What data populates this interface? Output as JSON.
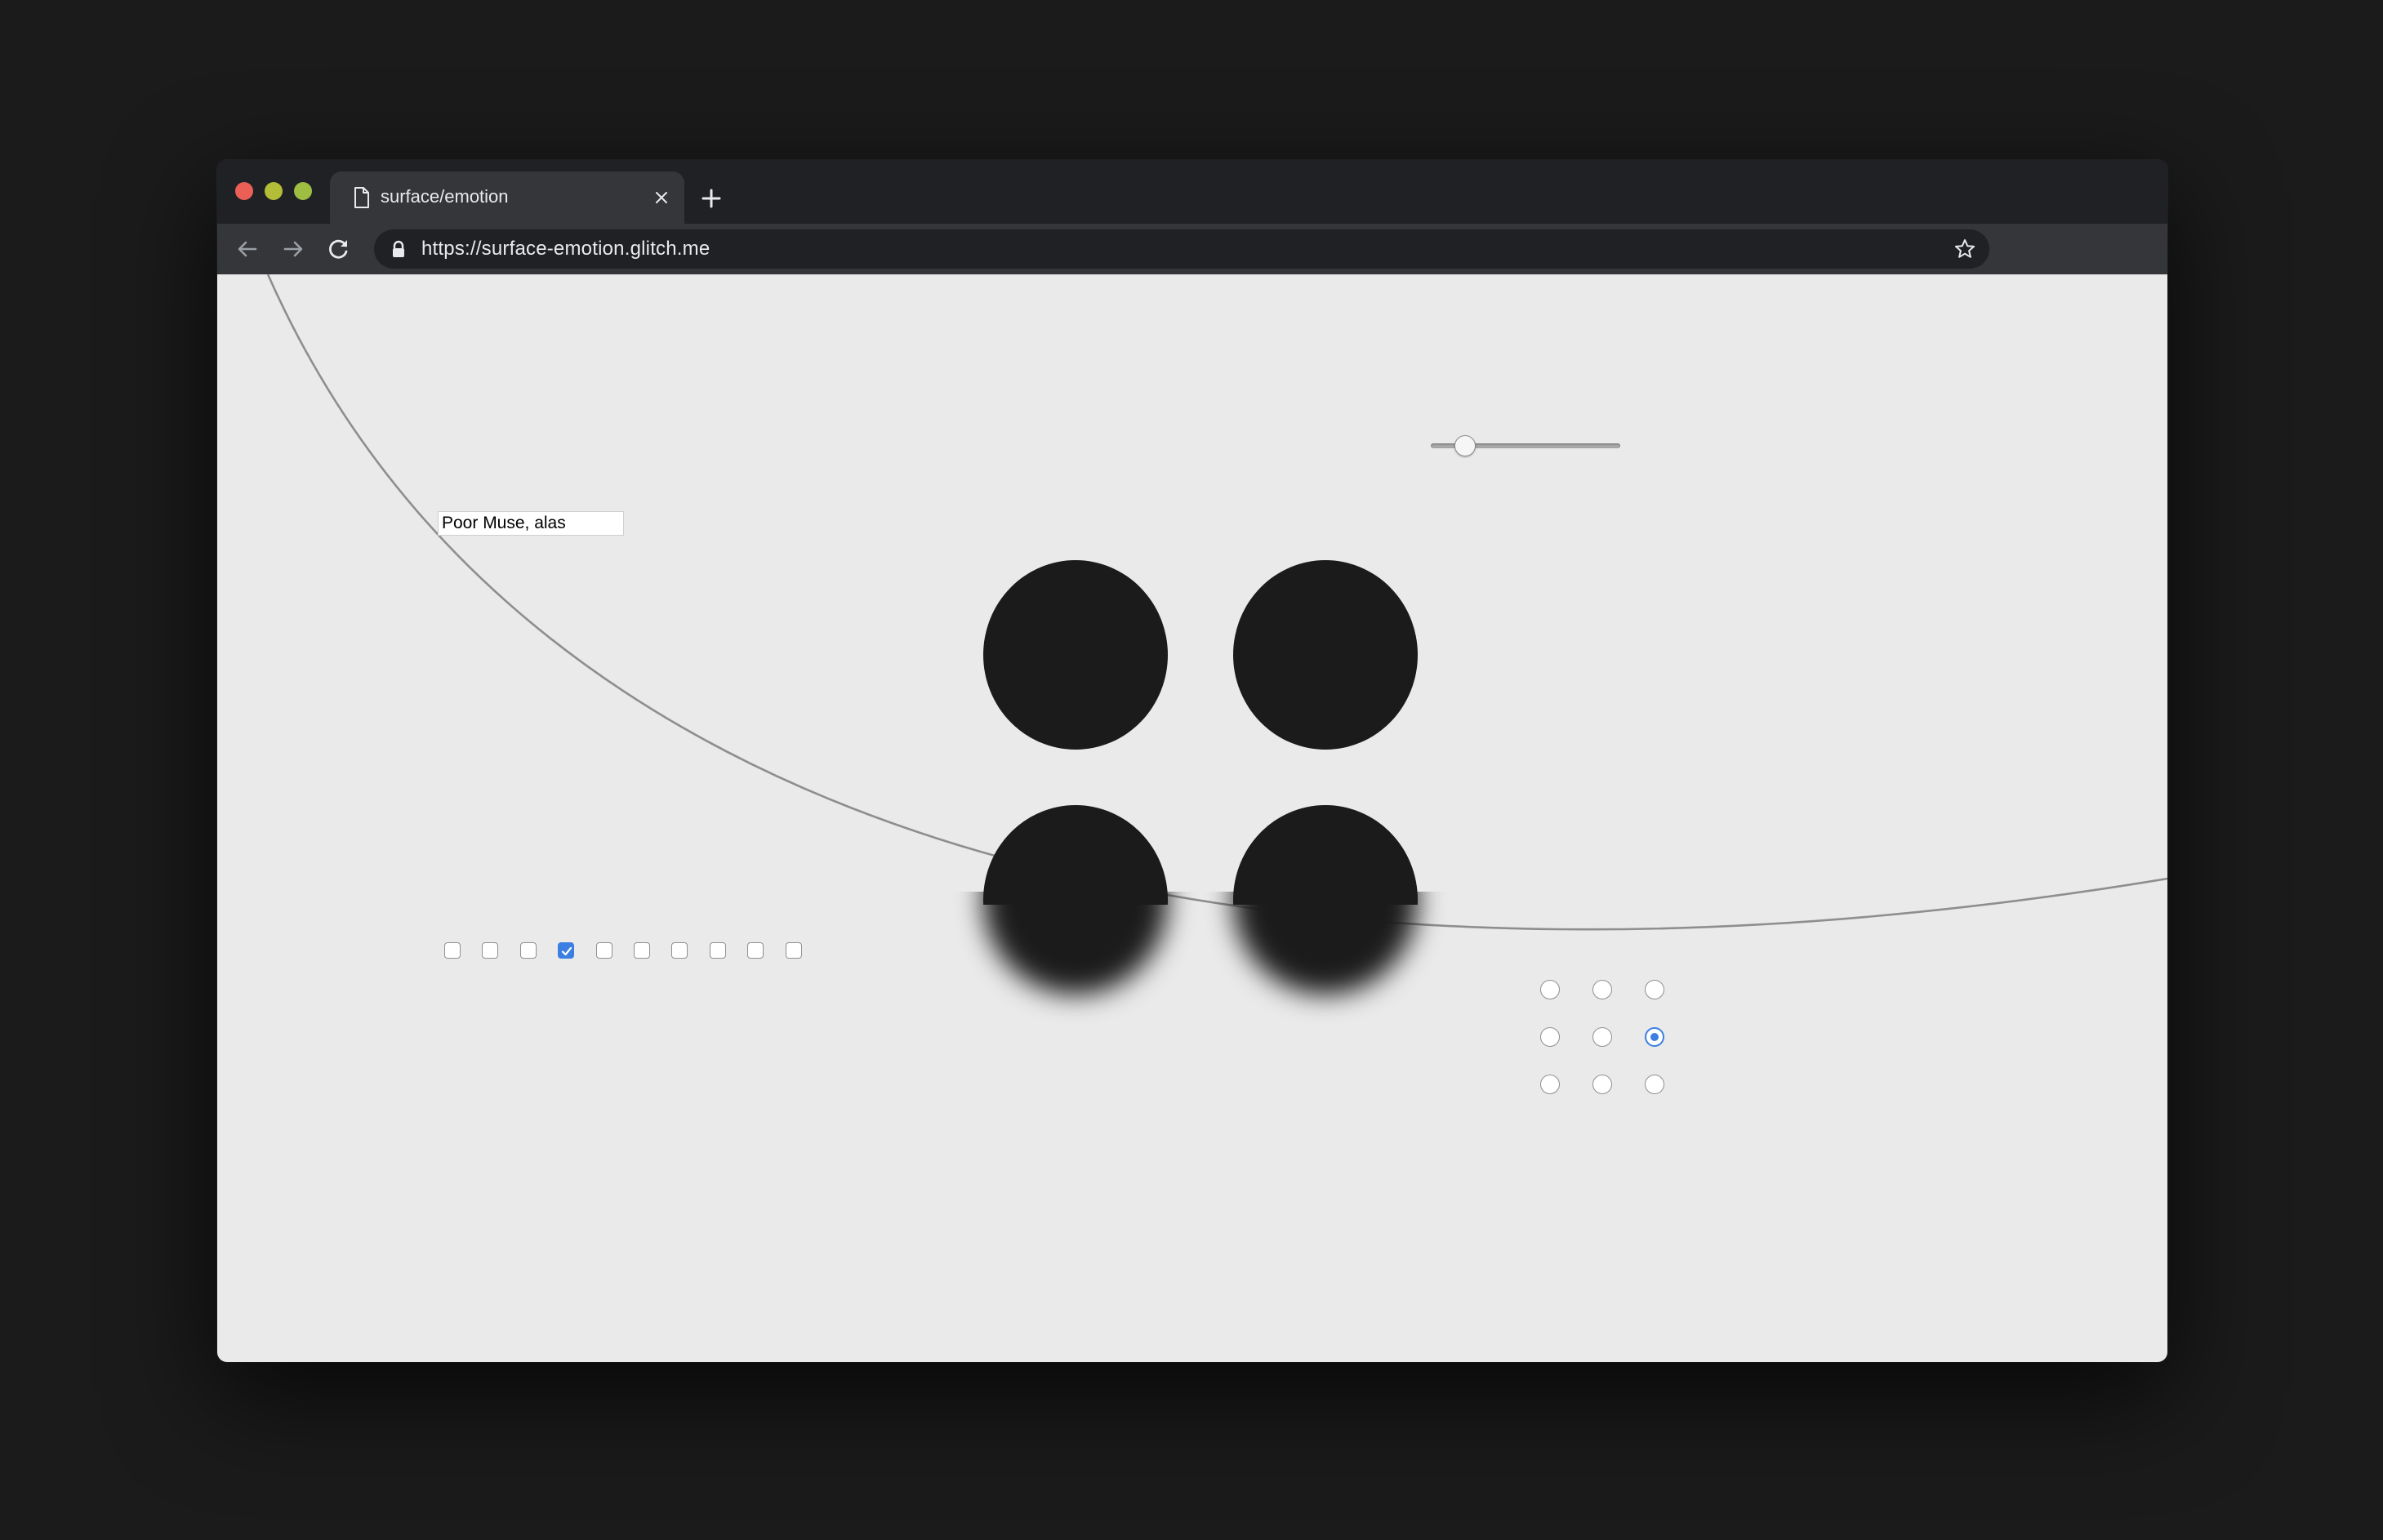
{
  "browser": {
    "tab": {
      "title": "surface/emotion",
      "icon": "document-icon"
    },
    "url": "https://surface-emotion.glitch.me",
    "icons": [
      "back-icon",
      "forward-icon",
      "reload-icon",
      "lock-icon",
      "star-icon",
      "close-icon",
      "plus-icon"
    ],
    "colors": {
      "frame": "#202124",
      "toolbar": "#35363a",
      "text": "#e8eaed",
      "traffic_close": "#ec5f57",
      "traffic_minimize": "#b4bd37",
      "traffic_zoom": "#9dbd43"
    }
  },
  "page": {
    "background": "#eaeaea",
    "text_input": {
      "value": "Poor Muse, alas"
    },
    "slider": {
      "value_fraction": 0.18
    },
    "checkboxes": [
      false,
      false,
      false,
      true,
      false,
      false,
      false,
      false,
      false,
      false
    ],
    "radios": {
      "rows": 3,
      "cols": 3,
      "selected_row": 1,
      "selected_col": 2
    },
    "circles": {
      "count": 4,
      "color": "#1b1b1b"
    },
    "accent": "#3a7fe1"
  }
}
